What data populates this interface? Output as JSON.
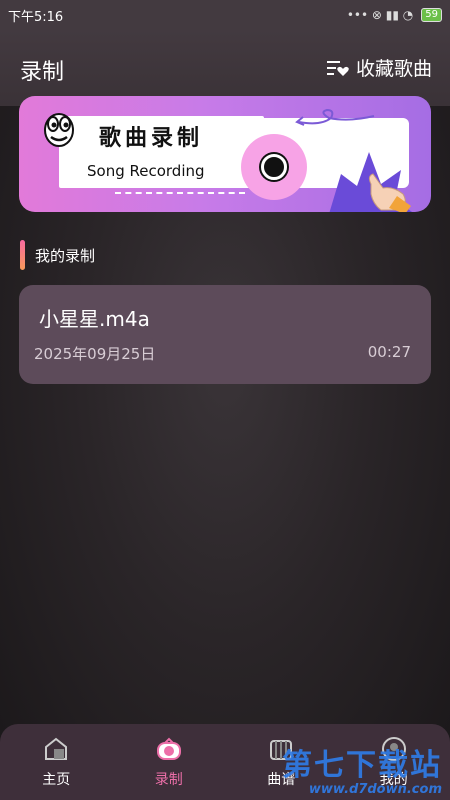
{
  "status_bar": {
    "time": "下午5:16",
    "icons": "••• ⊗ ▮▮ ◔",
    "battery": "59"
  },
  "header": {
    "title": "录制",
    "favorites_label": "收藏歌曲",
    "favorites_icon": "playlist-heart-icon"
  },
  "banner": {
    "title": "歌曲录制",
    "subtitle": "Song Recording"
  },
  "section": {
    "title": "我的录制"
  },
  "recordings": [
    {
      "name": "小星星.m4a",
      "date": "2025年09月25日",
      "duration": "00:27"
    }
  ],
  "tabs": [
    {
      "label": "主页",
      "icon": "home-icon",
      "active": false
    },
    {
      "label": "录制",
      "icon": "record-icon",
      "active": true
    },
    {
      "label": "曲谱",
      "icon": "score-icon",
      "active": false
    },
    {
      "label": "我的",
      "icon": "profile-icon",
      "active": false
    }
  ],
  "watermark": {
    "main": "第七下载站",
    "sub": "www.d7down.com"
  },
  "colors": {
    "accent": "#ec6fa8",
    "card": "#5d4b5a",
    "tabbar": "#3e2f3a"
  }
}
